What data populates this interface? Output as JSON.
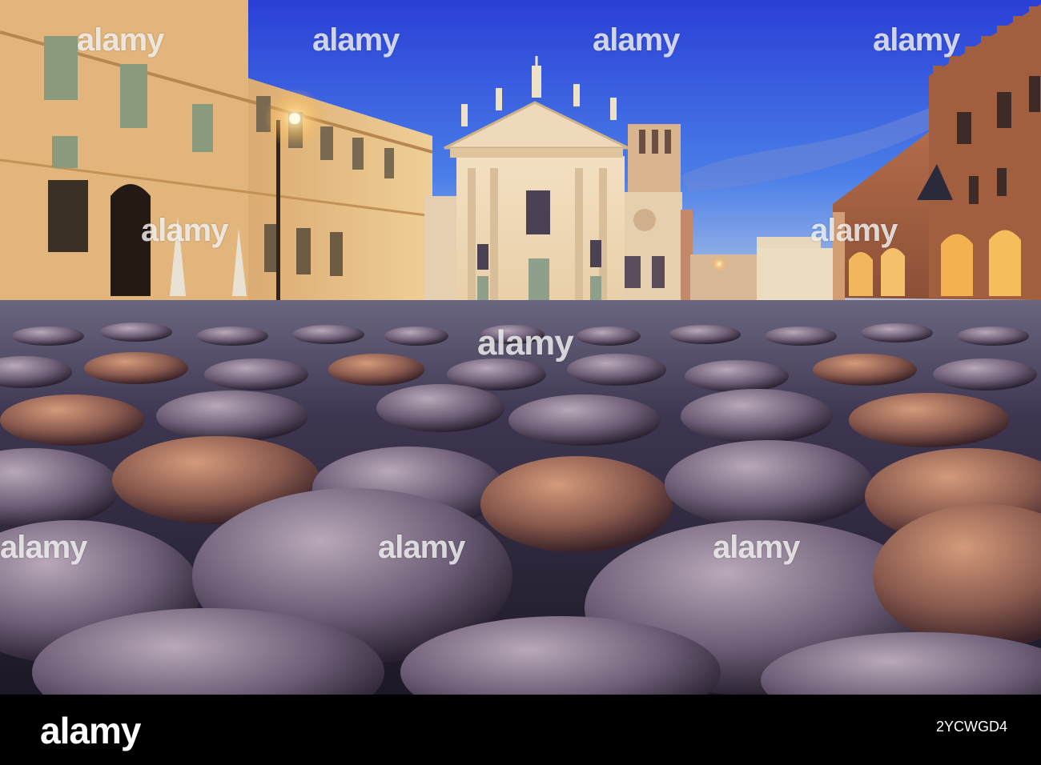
{
  "watermark": {
    "brand": "alamy"
  },
  "footer": {
    "logo": "alamy",
    "image_id": "2YCWGD4"
  }
}
